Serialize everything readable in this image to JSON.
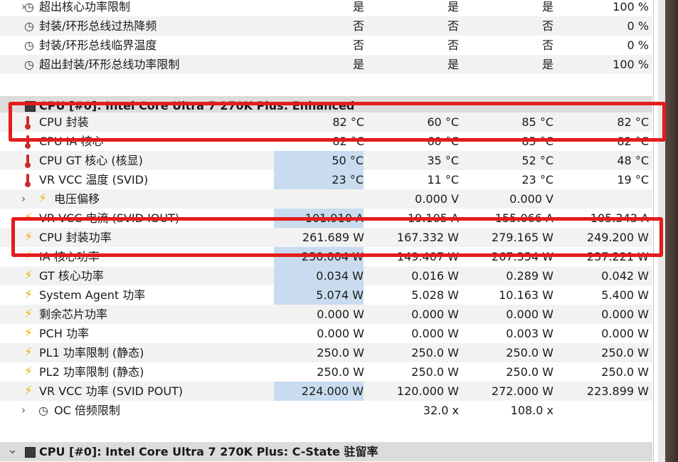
{
  "rows": [
    {
      "label": "超出核心功率限制",
      "icon": "clock",
      "chev": true,
      "v": [
        "是",
        "是",
        "是",
        "100 %"
      ],
      "hl": false,
      "alt": false
    },
    {
      "label": "封装/环形总线过热降频",
      "icon": "clock",
      "chev": false,
      "v": [
        "否",
        "否",
        "否",
        "0 %"
      ],
      "hl": false,
      "alt": true
    },
    {
      "label": "封装/环形总线临界温度",
      "icon": "clock",
      "chev": false,
      "v": [
        "否",
        "否",
        "否",
        "0 %"
      ],
      "hl": false,
      "alt": false
    },
    {
      "label": "超出封装/环形总线功率限制",
      "icon": "clock",
      "chev": false,
      "v": [
        "是",
        "是",
        "是",
        "100 %"
      ],
      "hl": false,
      "alt": true
    },
    {
      "label": "",
      "icon": "",
      "chev": false,
      "v": [
        "",
        "",
        "",
        ""
      ],
      "hl": false,
      "alt": false
    },
    {
      "label": "CPU [#0]: Intel Core Ultra 7 270K Plus: Enhanced",
      "icon": "chip",
      "chev": true,
      "v": [
        "",
        "",
        "",
        ""
      ],
      "hl": false,
      "alt": false,
      "hdr": true
    },
    {
      "label": "CPU 封装",
      "icon": "therm",
      "chev": false,
      "v": [
        "82 °C",
        "60 °C",
        "85 °C",
        "82 °C"
      ],
      "hl": false,
      "alt": true
    },
    {
      "label": "CPU IA 核心",
      "icon": "therm",
      "chev": false,
      "v": [
        "82 °C",
        "60 °C",
        "85 °C",
        "82 °C"
      ],
      "hl": false,
      "alt": false
    },
    {
      "label": "CPU GT 核心 (核显)",
      "icon": "therm",
      "chev": false,
      "v": [
        "50 °C",
        "35 °C",
        "52 °C",
        "48 °C"
      ],
      "hl": true,
      "alt": true
    },
    {
      "label": "VR VCC 温度 (SVID)",
      "icon": "therm",
      "chev": false,
      "v": [
        "23 °C",
        "11 °C",
        "23 °C",
        "19 °C"
      ],
      "hl": true,
      "alt": false
    },
    {
      "label": "电压偏移",
      "icon": "bolt",
      "chev": true,
      "nested": true,
      "v": [
        "",
        "0.000 V",
        "0.000 V",
        ""
      ],
      "hl": false,
      "alt": true
    },
    {
      "label": "VR VCC 电流 (SVID IOUT)",
      "icon": "bolt",
      "chev": false,
      "v": [
        "101.910 A",
        "19.105 A",
        "155.066 A",
        "105.343 A"
      ],
      "hl": true,
      "alt": false
    },
    {
      "label": "CPU 封装功率",
      "icon": "bolt",
      "chev": false,
      "v": [
        "261.689 W",
        "167.332 W",
        "279.165 W",
        "249.200 W"
      ],
      "hl": false,
      "alt": true
    },
    {
      "label": "IA 核心功率",
      "icon": "bolt",
      "chev": false,
      "v": [
        "250.004 W",
        "149.407 W",
        "267.354 W",
        "237.221 W"
      ],
      "hl": true,
      "alt": false
    },
    {
      "label": "GT 核心功率",
      "icon": "bolt",
      "chev": false,
      "v": [
        "0.034 W",
        "0.016 W",
        "0.289 W",
        "0.042 W"
      ],
      "hl": true,
      "alt": true
    },
    {
      "label": "System Agent 功率",
      "icon": "bolt",
      "chev": false,
      "v": [
        "5.074 W",
        "5.028 W",
        "10.163 W",
        "5.400 W"
      ],
      "hl": true,
      "alt": false
    },
    {
      "label": "剩余芯片功率",
      "icon": "bolt",
      "chev": false,
      "v": [
        "0.000 W",
        "0.000 W",
        "0.000 W",
        "0.000 W"
      ],
      "hl": false,
      "alt": true
    },
    {
      "label": "PCH 功率",
      "icon": "bolt",
      "chev": false,
      "v": [
        "0.000 W",
        "0.000 W",
        "0.003 W",
        "0.000 W"
      ],
      "hl": false,
      "alt": false
    },
    {
      "label": "PL1 功率限制 (静态)",
      "icon": "bolt",
      "chev": false,
      "v": [
        "250.0 W",
        "250.0 W",
        "250.0 W",
        "250.0 W"
      ],
      "hl": false,
      "alt": true
    },
    {
      "label": "PL2 功率限制 (静态)",
      "icon": "bolt",
      "chev": false,
      "v": [
        "250.0 W",
        "250.0 W",
        "250.0 W",
        "250.0 W"
      ],
      "hl": false,
      "alt": false
    },
    {
      "label": "VR VCC 功率 (SVID POUT)",
      "icon": "bolt",
      "chev": false,
      "v": [
        "224.000 W",
        "120.000 W",
        "272.000 W",
        "223.899 W"
      ],
      "hl": true,
      "alt": true
    },
    {
      "label": "OC 倍频限制",
      "icon": "clock",
      "chev": true,
      "nested": true,
      "v": [
        "",
        "32.0 x",
        "108.0 x",
        ""
      ],
      "hl": false,
      "alt": false
    },
    {
      "label": "",
      "icon": "",
      "chev": false,
      "v": [
        "",
        "",
        "",
        ""
      ],
      "hl": false,
      "alt": false
    },
    {
      "label": "CPU [#0]: Intel Core Ultra 7 270K Plus: C-State 驻留率",
      "icon": "chip",
      "chev": true,
      "v": [
        "",
        "",
        "",
        ""
      ],
      "hl": false,
      "alt": false,
      "hdr": true,
      "open": true
    }
  ]
}
